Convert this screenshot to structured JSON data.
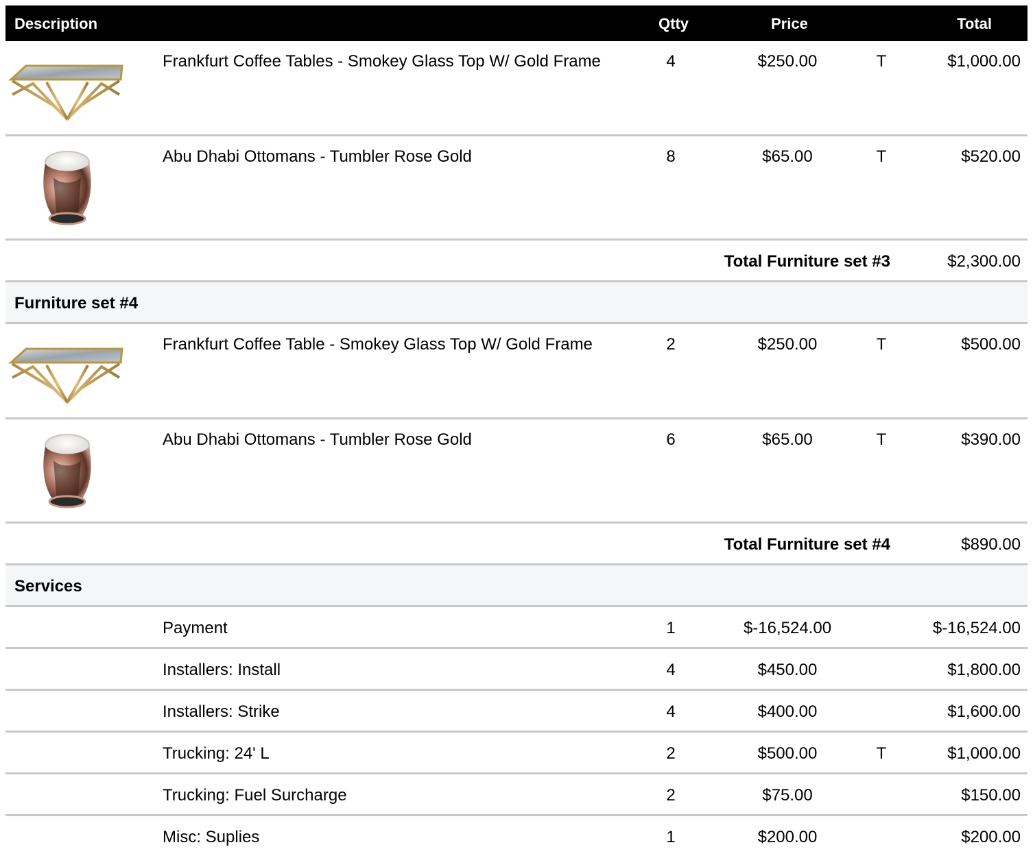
{
  "header": {
    "description": "Description",
    "qty": "Qtty",
    "price": "Price",
    "total": "Total"
  },
  "set3_items": [
    {
      "description": "Frankfurt Coffee Tables - Smokey Glass Top W/ Gold Frame",
      "qty": "4",
      "price": "$250.00",
      "tax": "T",
      "total": "$1,000.00",
      "image_icon": "coffee-table-icon"
    },
    {
      "description": "Abu Dhabi Ottomans - Tumbler Rose Gold",
      "qty": "8",
      "price": "$65.00",
      "tax": "T",
      "total": "$520.00",
      "image_icon": "ottoman-icon"
    }
  ],
  "set3_subtotal": {
    "label": "Total Furniture set #3",
    "total": "$2,300.00"
  },
  "set4": {
    "title": "Furniture set #4"
  },
  "set4_items": [
    {
      "description": "Frankfurt Coffee Table - Smokey Glass Top W/ Gold Frame",
      "qty": "2",
      "price": "$250.00",
      "tax": "T",
      "total": "$500.00",
      "image_icon": "coffee-table-icon"
    },
    {
      "description": "Abu Dhabi Ottomans - Tumbler Rose Gold",
      "qty": "6",
      "price": "$65.00",
      "tax": "T",
      "total": "$390.00",
      "image_icon": "ottoman-icon"
    }
  ],
  "set4_subtotal": {
    "label": "Total Furniture set #4",
    "total": "$890.00"
  },
  "services": {
    "title": "Services",
    "items": [
      {
        "description": "Payment",
        "qty": "1",
        "price": "$-16,524.00",
        "tax": "",
        "total": "$-16,524.00"
      },
      {
        "description": "Installers: Install",
        "qty": "4",
        "price": "$450.00",
        "tax": "",
        "total": "$1,800.00"
      },
      {
        "description": "Installers: Strike",
        "qty": "4",
        "price": "$400.00",
        "tax": "",
        "total": "$1,600.00"
      },
      {
        "description": "Trucking: 24' L",
        "qty": "2",
        "price": "$500.00",
        "tax": "T",
        "total": "$1,000.00"
      },
      {
        "description": "Trucking: Fuel Surcharge",
        "qty": "2",
        "price": "$75.00",
        "tax": "",
        "total": "$150.00"
      },
      {
        "description": "Misc: Suplies",
        "qty": "1",
        "price": "$200.00",
        "tax": "",
        "total": "$200.00"
      }
    ]
  },
  "colors": {
    "header_bg": "#000000",
    "group_bg": "#f5f6f7",
    "divider": "#c8c8c8"
  }
}
